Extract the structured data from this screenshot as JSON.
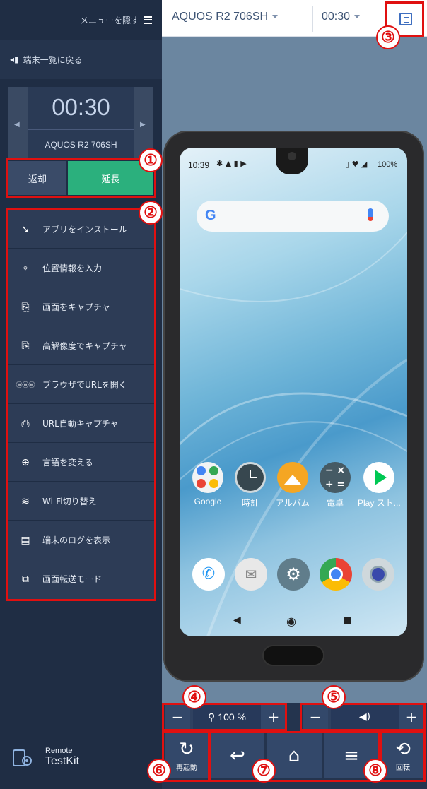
{
  "sidebar": {
    "hide_menu_label": "メニューを隠す",
    "back_label": "端末一覧に戻る",
    "timer": "00:30",
    "device_name": "AQUOS R2 706SH",
    "return_label": "返却",
    "extend_label": "延長",
    "menu": [
      {
        "label": "アプリをインストール",
        "icon": "install-icon"
      },
      {
        "label": "位置情報を入力",
        "icon": "location-icon"
      },
      {
        "label": "画面をキャプチャ",
        "icon": "capture-icon"
      },
      {
        "label": "高解像度でキャプチャ",
        "icon": "hires-capture-icon"
      },
      {
        "label": "ブラウザでURLを開く",
        "icon": "www-icon"
      },
      {
        "label": "URL自動キャプチャ",
        "icon": "url-capture-icon"
      },
      {
        "label": "言語を変える",
        "icon": "globe-icon"
      },
      {
        "label": "Wi-Fi切り替え",
        "icon": "wifi-icon"
      },
      {
        "label": "端末のログを表示",
        "icon": "log-icon"
      },
      {
        "label": "画面転送モード",
        "icon": "transfer-icon"
      }
    ],
    "logo_line1": "Remote",
    "logo_line2": "TestKit"
  },
  "topbar": {
    "model": "AQUOS R2 706SH",
    "time": "00:30"
  },
  "phone": {
    "status_time": "10:39",
    "battery": "100%",
    "apps": [
      {
        "label": "Google"
      },
      {
        "label": "時計"
      },
      {
        "label": "アルバム"
      },
      {
        "label": "電卓"
      },
      {
        "label": "Play スト..."
      }
    ],
    "dock": [
      "phone-icon",
      "softbank-mail-icon",
      "settings-icon",
      "chrome-icon",
      "camera-icon"
    ]
  },
  "controls": {
    "zoom": "100 %",
    "restart_label": "再起動",
    "rotate_label": "回転"
  },
  "annotations": [
    "①",
    "②",
    "③",
    "④",
    "⑤",
    "⑥",
    "⑦",
    "⑧"
  ],
  "colors": {
    "sidebar_bg": "#1f2d44",
    "extend_green": "#2bb07d",
    "annotation_red": "#e01010"
  }
}
